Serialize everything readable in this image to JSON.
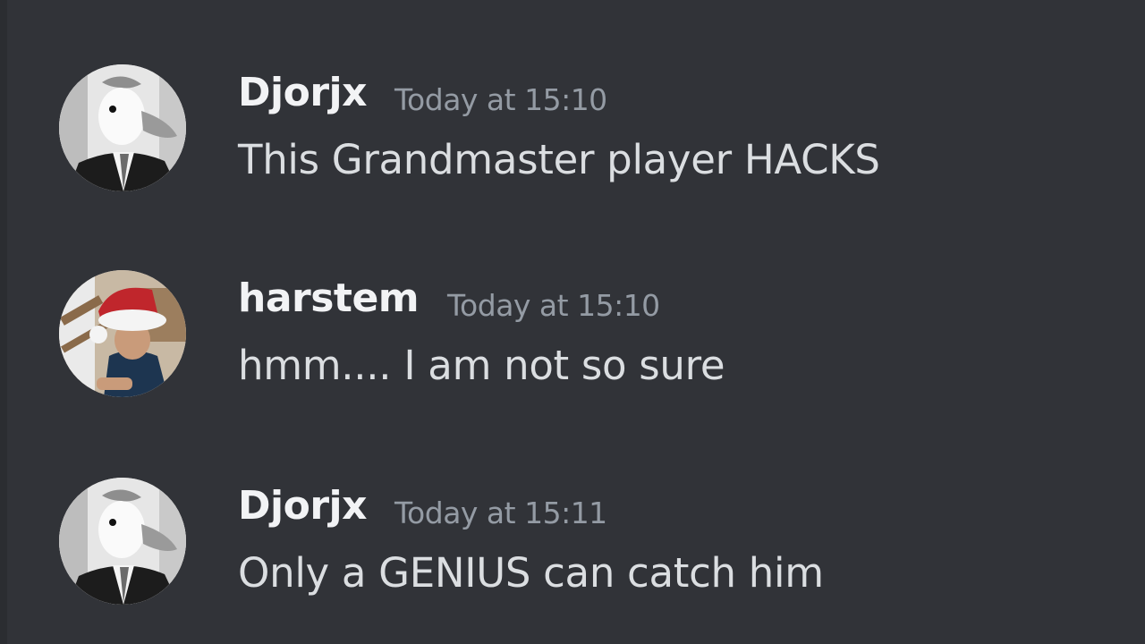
{
  "messages": [
    {
      "username": "Djorjx",
      "timestamp": "Today at 15:10",
      "text": "This Grandmaster player HACKS",
      "avatar_icon": "goose-in-suit-avatar"
    },
    {
      "username": "harstem",
      "timestamp": "Today at 15:10",
      "text": "hmm.... I am not so sure",
      "avatar_icon": "santa-hat-person-avatar"
    },
    {
      "username": "Djorjx",
      "timestamp": "Today at 15:11",
      "text": "Only a GENIUS can catch him",
      "avatar_icon": "goose-in-suit-avatar"
    }
  ],
  "colors": {
    "background": "#313338",
    "username": "#f2f3f5",
    "timestamp": "#949ba4",
    "message_text": "#dbdee1"
  }
}
